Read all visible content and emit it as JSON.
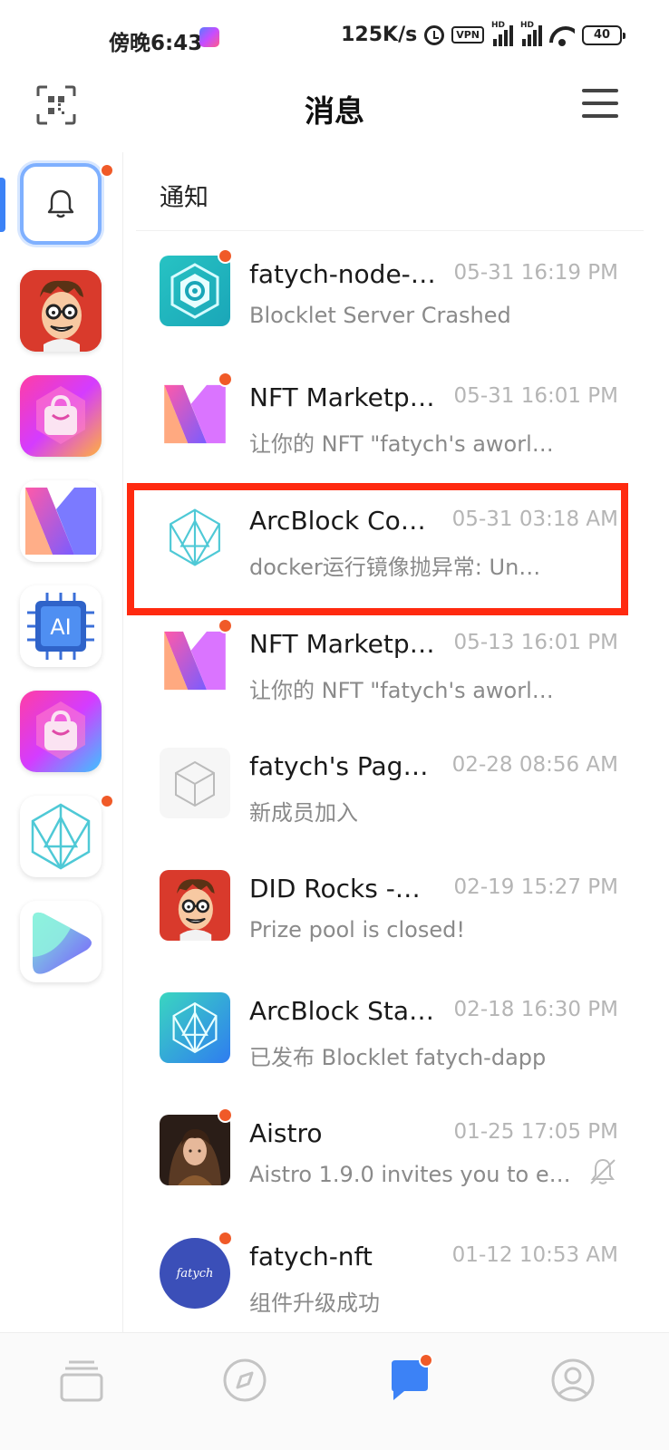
{
  "status_bar": {
    "time": "傍晚6:43",
    "network_speed": "125K/s",
    "vpn_label": "VPN",
    "battery": "40",
    "signal_label": "HD"
  },
  "header": {
    "title": "消息"
  },
  "section": {
    "title": "通知"
  },
  "sidebar": {
    "apps": [
      {
        "name": "notifications",
        "icon": "bell-icon",
        "unread": true
      },
      {
        "name": "did-rocks",
        "icon": "cartoon-avatar-icon",
        "unread": false
      },
      {
        "name": "nft-store",
        "icon": "shopping-bag-icon",
        "unread": false
      },
      {
        "name": "nft-marketplace",
        "icon": "m-logo-icon",
        "unread": false
      },
      {
        "name": "ai-app",
        "icon": "ai-chip-icon",
        "unread": false
      },
      {
        "name": "nft-store-2",
        "icon": "shopping-bag-icon",
        "unread": false
      },
      {
        "name": "arcblock",
        "icon": "arcblock-cube-icon",
        "unread": true
      },
      {
        "name": "play-app",
        "icon": "play-shape-icon",
        "unread": false
      }
    ]
  },
  "notifications": [
    {
      "title": "fatych-node-…",
      "time": "05-31 16:19 PM",
      "subtitle": "Blocklet Server Crashed",
      "icon": "gear-hexagon-icon",
      "unread": true,
      "muted": false
    },
    {
      "title": "NFT Marketp…",
      "time": "05-31 16:01 PM",
      "subtitle": "让你的 NFT \"fatych's aworl…",
      "icon": "m-logo-icon",
      "unread": true,
      "muted": false
    },
    {
      "title": "ArcBlock Co…",
      "time": "05-31 03:18 AM",
      "subtitle": "docker运行镜像抛异常: Un…",
      "icon": "arcblock-cube-icon",
      "unread": false,
      "muted": false
    },
    {
      "title": "NFT Marketp…",
      "time": "05-13 16:01 PM",
      "subtitle": "让你的 NFT \"fatych's aworl…",
      "icon": "m-logo-icon",
      "unread": true,
      "muted": false
    },
    {
      "title": "fatych's Pag…",
      "time": "02-28 08:56 AM",
      "subtitle": "新成员加入",
      "icon": "cube-outline-icon",
      "unread": false,
      "muted": false
    },
    {
      "title": "DID Rocks -…",
      "time": "02-19 15:27 PM",
      "subtitle": "Prize pool is closed!",
      "icon": "cartoon-avatar-icon",
      "unread": false,
      "muted": false
    },
    {
      "title": "ArcBlock Sta…",
      "time": "02-18 16:30 PM",
      "subtitle": "已发布 Blocklet fatych-dapp",
      "icon": "arcblock-cube-icon",
      "unread": false,
      "muted": false
    },
    {
      "title": "Aistro",
      "time": "01-25 17:05 PM",
      "subtitle": "Aistro 1.9.0 invites you to e…",
      "icon": "portrait-icon",
      "unread": true,
      "muted": true
    },
    {
      "title": "fatych-nft",
      "time": "01-12 10:53 AM",
      "subtitle": "组件升级成功",
      "icon": "fatych-logo-icon",
      "fatych_logo_text": "fatych",
      "unread": true,
      "muted": false
    }
  ],
  "bottom_nav": [
    {
      "name": "apps",
      "icon": "stack-icon",
      "active": false
    },
    {
      "name": "explore",
      "icon": "compass-icon",
      "active": false
    },
    {
      "name": "messages",
      "icon": "chat-bubble-icon",
      "active": true,
      "unread": true
    },
    {
      "name": "profile",
      "icon": "user-circle-icon",
      "active": false
    }
  ],
  "colors": {
    "accent": "#3c82f6",
    "unread_dot": "#f05a28",
    "highlight": "#ff2a10",
    "muted_text": "#8a8a8a",
    "time_text": "#b5b5b5"
  }
}
